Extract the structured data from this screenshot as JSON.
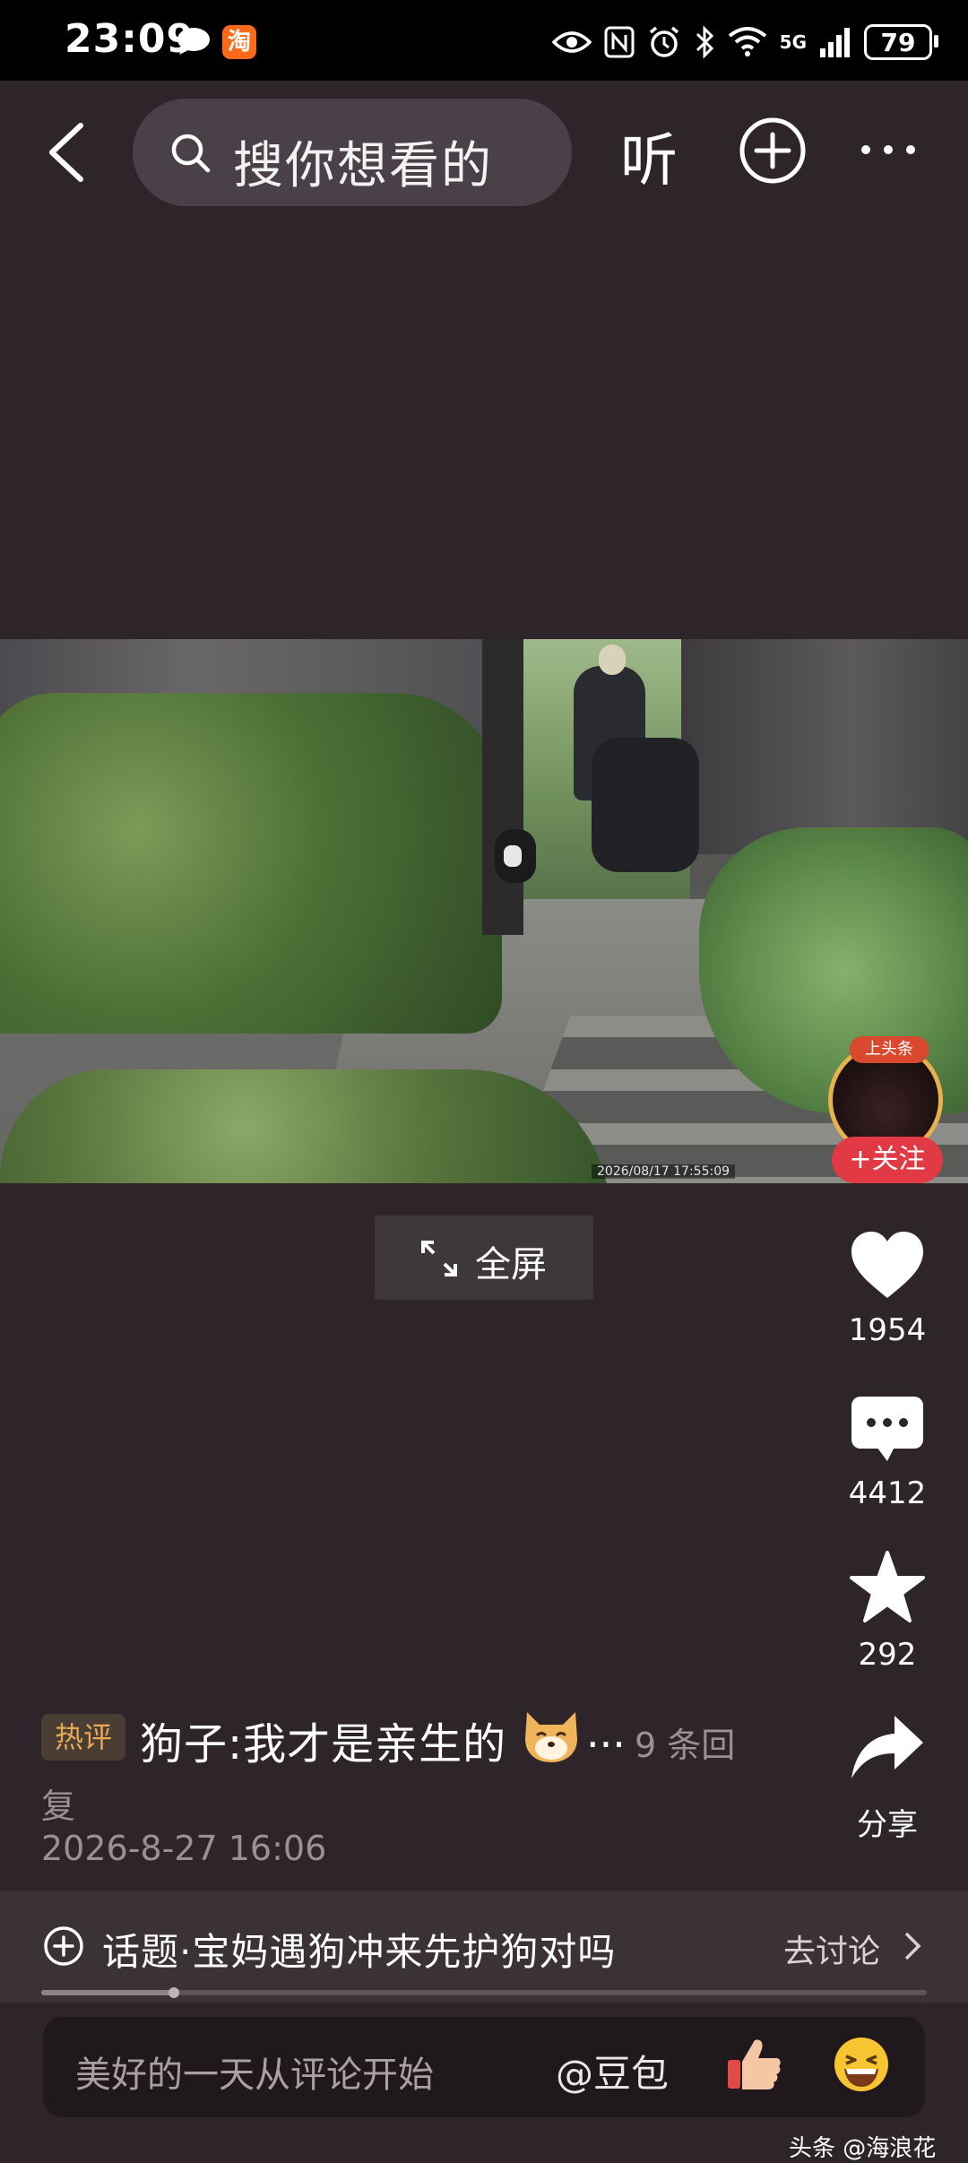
{
  "status_bar": {
    "time": "23:09",
    "app_badge": "淘",
    "network": "5G",
    "battery": "79"
  },
  "nav": {
    "search_placeholder": "搜你想看的",
    "listen_label": "听"
  },
  "video": {
    "timestamp": "2026/08/17 17:55:09"
  },
  "author": {
    "follow_label": "+关注",
    "badge": "上头条"
  },
  "player": {
    "fullscreen_label": "全屏"
  },
  "actions": {
    "likes": "1954",
    "comments": "4412",
    "favorites": "292",
    "share_label": "分享"
  },
  "hot_comment": {
    "tag": "热评",
    "text": "狗子:我才是亲生的",
    "ellipsis": "...",
    "reply_count_part1": "9 条回",
    "reply_count_part2": "复",
    "date": "2026-8-27 16:06"
  },
  "topic": {
    "text": "话题·宝妈遇狗冲来先护狗对吗",
    "go_label": "去讨论",
    "progress": 0.15
  },
  "comment_bar": {
    "placeholder": "美好的一天从评论开始",
    "mention": "@豆包"
  },
  "watermark": "头条 @海浪花",
  "colors": {
    "background": "#2e252b",
    "follow": "#e23a45",
    "hot_tag_text": "#e8a957"
  }
}
